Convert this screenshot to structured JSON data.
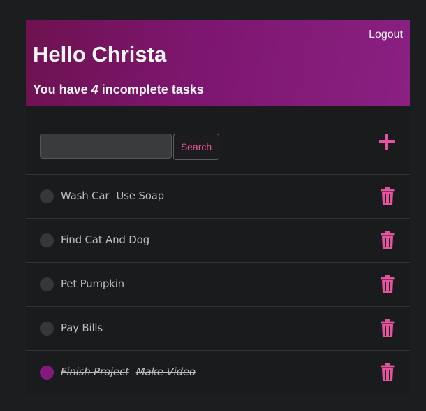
{
  "header": {
    "logout_label": "Logout",
    "greeting": "Hello Christa",
    "summary_prefix": "You have ",
    "incomplete_count": "4",
    "summary_suffix": " incomplete tasks"
  },
  "search": {
    "placeholder": "",
    "value": "",
    "button_label": "Search"
  },
  "icons": {
    "add": "plus-icon",
    "delete": "trash-icon"
  },
  "colors": {
    "accent": "#e5539f",
    "complete_check": "#86197d",
    "header_gradient_start": "#6e1250",
    "header_gradient_end": "#8a2082"
  },
  "tasks": [
    {
      "title": "Wash Car",
      "note": "Use Soap",
      "completed": false
    },
    {
      "title": "Find Cat And Dog",
      "note": "",
      "completed": false
    },
    {
      "title": "Pet Pumpkin",
      "note": "",
      "completed": false
    },
    {
      "title": "Pay Bills",
      "note": "",
      "completed": false
    },
    {
      "title": "Finish Project",
      "note": "Make Video",
      "completed": true
    }
  ]
}
